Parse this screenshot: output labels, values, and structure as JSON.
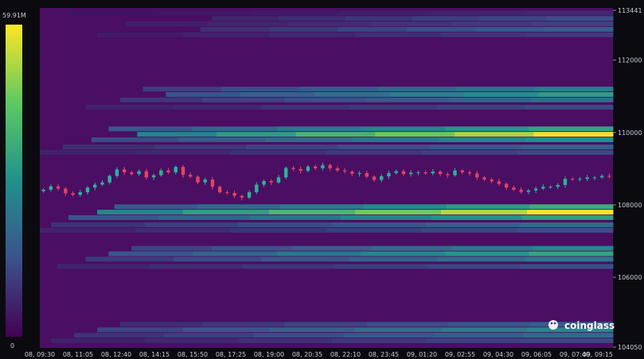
{
  "chart_data": {
    "type": "heatmap",
    "title": "",
    "xlabel": "",
    "ylabel": "",
    "colorbar": {
      "min_label": "0",
      "max_label": "59.91M",
      "min": 0,
      "max": 59.91,
      "unit": "M",
      "colors": [
        "#440154",
        "#3b528b",
        "#21918c",
        "#5ec962",
        "#fde725"
      ]
    },
    "background_color": "#4a0e63",
    "ylim": [
      104050,
      113441
    ],
    "y_ticks": [
      "113441",
      "112000",
      "110000",
      "108000",
      "106000",
      "104050"
    ],
    "y_tick_values": [
      113441,
      112000,
      110000,
      108000,
      106000,
      104050
    ],
    "x_ticks": [
      "08, 09:30",
      "08, 11:05",
      "08, 12:40",
      "08, 14:15",
      "08, 15:50",
      "08, 17:25",
      "08, 19:00",
      "08, 20:35",
      "08, 22:10",
      "08, 23:45",
      "09, 01:20",
      "09, 02:55",
      "09, 04:30",
      "09, 06:05",
      "09, 07:40",
      "09, 09:15"
    ],
    "liquidation_bands": [
      {
        "price": 113300,
        "start": 0.05,
        "intensity": 0.12
      },
      {
        "price": 113150,
        "start": 0.3,
        "intensity": 0.24
      },
      {
        "price": 113000,
        "start": 0.15,
        "intensity": 0.2
      },
      {
        "price": 112850,
        "start": 0.28,
        "intensity": 0.3
      },
      {
        "price": 112700,
        "start": 0.1,
        "intensity": 0.18
      },
      {
        "price": 111200,
        "start": 0.18,
        "intensity": 0.42
      },
      {
        "price": 111050,
        "start": 0.22,
        "intensity": 0.55
      },
      {
        "price": 110900,
        "start": 0.14,
        "intensity": 0.36
      },
      {
        "price": 110700,
        "start": 0.08,
        "intensity": 0.22
      },
      {
        "price": 110100,
        "start": 0.12,
        "intensity": 0.58
      },
      {
        "price": 109950,
        "start": 0.17,
        "intensity": 0.97
      },
      {
        "price": 109800,
        "start": 0.09,
        "intensity": 0.5
      },
      {
        "price": 109600,
        "start": 0.04,
        "intensity": 0.3
      },
      {
        "price": 109450,
        "start": 0.0,
        "intensity": 0.22
      },
      {
        "price": 107950,
        "start": 0.13,
        "intensity": 0.62
      },
      {
        "price": 107800,
        "start": 0.1,
        "intensity": 0.99
      },
      {
        "price": 107650,
        "start": 0.05,
        "intensity": 0.56
      },
      {
        "price": 107450,
        "start": 0.02,
        "intensity": 0.34
      },
      {
        "price": 107300,
        "start": 0.0,
        "intensity": 0.24
      },
      {
        "price": 106800,
        "start": 0.16,
        "intensity": 0.46
      },
      {
        "price": 106650,
        "start": 0.12,
        "intensity": 0.58
      },
      {
        "price": 106500,
        "start": 0.08,
        "intensity": 0.4
      },
      {
        "price": 106300,
        "start": 0.03,
        "intensity": 0.24
      },
      {
        "price": 104700,
        "start": 0.14,
        "intensity": 0.3
      },
      {
        "price": 104550,
        "start": 0.1,
        "intensity": 0.46
      },
      {
        "price": 104400,
        "start": 0.06,
        "intensity": 0.34
      },
      {
        "price": 104250,
        "start": 0.02,
        "intensity": 0.22
      }
    ],
    "candles": [
      108420,
      108510,
      108450,
      108320,
      108280,
      108350,
      108480,
      108560,
      108620,
      108800,
      108980,
      108900,
      108850,
      108930,
      108760,
      108820,
      108950,
      108900,
      109050,
      108830,
      108780,
      108620,
      108700,
      108500,
      108350,
      108330,
      108250,
      108200,
      108350,
      108560,
      108660,
      108620,
      108760,
      109020,
      108990,
      108940,
      109060,
      109010,
      109100,
      109010,
      108950,
      108920,
      108860,
      108880,
      108780,
      108690,
      108790,
      108880,
      108930,
      108850,
      108890,
      108900,
      108870,
      108920,
      108850,
      108820,
      108950,
      108900,
      108870,
      108760,
      108700,
      108650,
      108580,
      108480,
      108420,
      108360,
      108400,
      108450,
      108500,
      108500,
      108550,
      108720,
      108700,
      108720,
      108760,
      108760,
      108800,
      108780
    ],
    "brand": "coinglass"
  }
}
